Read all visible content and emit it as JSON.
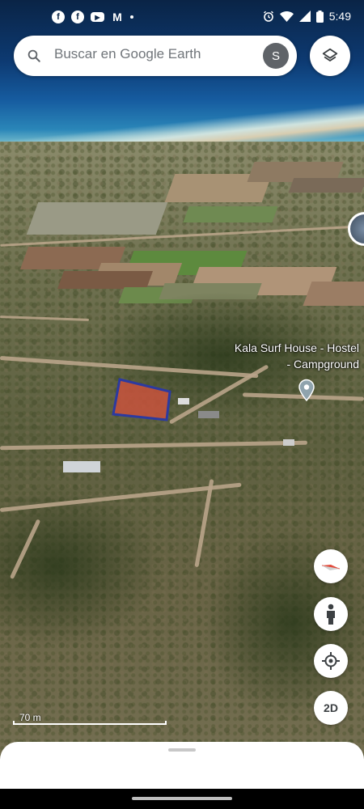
{
  "status_bar": {
    "time": "5:49",
    "notification_icons": [
      "facebook-icon",
      "facebook-icon",
      "youtube-icon",
      "gmail-icon",
      "dot-icon"
    ],
    "status_icons": [
      "alarm-icon",
      "wifi-icon",
      "signal-icon",
      "battery-icon"
    ]
  },
  "search": {
    "placeholder": "Buscar en Google Earth",
    "avatar_letter": "S"
  },
  "map": {
    "place_label": "Kala Surf House - Hostel - Campground",
    "scale_label": "70 m",
    "polygon_fill": "#c8523c",
    "polygon_stroke": "#2c3aa0"
  },
  "controls": {
    "view_mode": "2D"
  },
  "colors": {
    "accent": "#1a73e8",
    "surface": "#ffffff",
    "icon": "#3c4043"
  }
}
